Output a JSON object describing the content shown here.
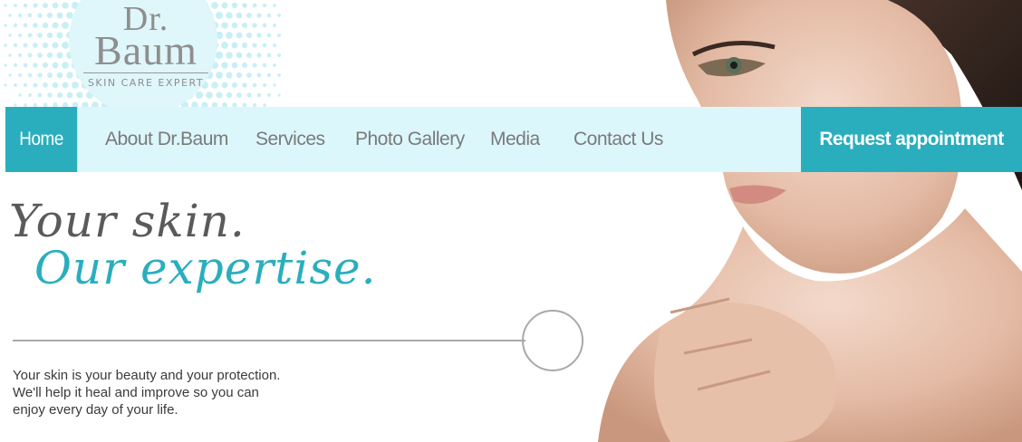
{
  "logo": {
    "line1": "Dr.",
    "line2": "Baum",
    "subtitle": "SKIN CARE EXPERT"
  },
  "nav": {
    "items": [
      {
        "label": "Home",
        "active": true
      },
      {
        "label": "About Dr.Baum"
      },
      {
        "label": "Services"
      },
      {
        "label": "Photo Gallery"
      },
      {
        "label": "Media"
      },
      {
        "label": "Contact Us"
      }
    ],
    "cta": "Request appointment"
  },
  "hero": {
    "tagline_1": "Your skin.",
    "tagline_2": "Our expertise.",
    "description": [
      "Your skin is your beauty and your protection.",
      "We'll help it heal and improve so you can",
      "enjoy every day of your life."
    ],
    "photo_icon": "woman-portrait"
  },
  "colors": {
    "accent": "#2aaebd",
    "nav_bg": "#dcf7fb",
    "text_gray": "#7a7a7a"
  }
}
